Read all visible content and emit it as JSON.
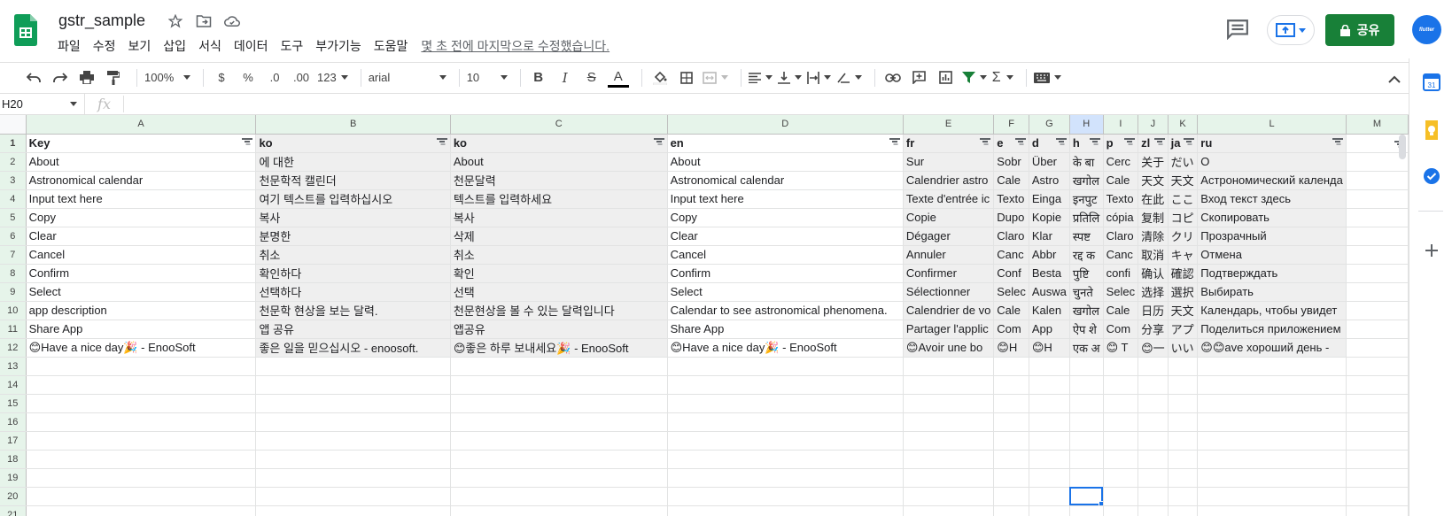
{
  "app": {
    "title": "gstr_sample",
    "last_edit": "몇 초 전에 마지막으로 수정했습니다.",
    "brand_color": "#0f9d58",
    "share_color": "#188038"
  },
  "menu": [
    "파일",
    "수정",
    "보기",
    "삽입",
    "서식",
    "데이터",
    "도구",
    "부가기능",
    "도움말"
  ],
  "header_actions": {
    "share_label": "공유",
    "avatar_text": "flutter"
  },
  "toolbar": {
    "zoom": "100%",
    "currency": "$",
    "percent": "%",
    "decrease_decimal": ".0",
    "increase_decimal": ".00",
    "more_formats": "123",
    "font": "arial",
    "font_size": "10",
    "bold": "B",
    "italic": "I",
    "strike": "S",
    "text_color": "A",
    "sum": "Σ"
  },
  "formula_bar": {
    "cell_ref": "H20",
    "fx": "fx",
    "value": ""
  },
  "sheet": {
    "columns": [
      "A",
      "B",
      "C",
      "D",
      "E",
      "F",
      "G",
      "H",
      "I",
      "J",
      "K",
      "L",
      "M"
    ],
    "row_numbers": [
      "1",
      "2",
      "3",
      "4",
      "5",
      "6",
      "7",
      "8",
      "9",
      "10",
      "11",
      "12",
      "13",
      "14",
      "15",
      "16",
      "17",
      "18",
      "19",
      "20",
      "21"
    ],
    "rows": [
      [
        "Key",
        "ko",
        "ko",
        "en",
        "fr",
        "e",
        "d",
        "h",
        "p",
        "zl",
        "ja",
        "ru",
        ""
      ],
      [
        "About",
        "에 대한",
        "About",
        "About",
        "Sur",
        "Sobr",
        "Über",
        "के बा",
        "Cerc",
        "关于",
        "だい",
        "О",
        ""
      ],
      [
        "Astronomical calendar",
        "천문학적 캘린더",
        "천문달력",
        "Astronomical calendar",
        "Calendrier astro",
        "Cale",
        "Astro",
        "खगोल",
        "Cale",
        "天文",
        "天文",
        "Астрономический календа",
        ""
      ],
      [
        "Input text here",
        "여기 텍스트를 입력하십시오",
        "텍스트를 입력하세요",
        "Input text here",
        "Texte d'entrée ic",
        "Texto",
        "Einga",
        "इनपुट",
        "Texto",
        "在此",
        "ここ",
        "Вход текст здесь",
        ""
      ],
      [
        "Copy",
        "복사",
        "복사",
        "Copy",
        "Copie",
        "Dupo",
        "Kopie",
        "प्रतिलि",
        "cópia",
        "复制",
        "コピ",
        "Скопировать",
        ""
      ],
      [
        "Clear",
        "분명한",
        "삭제",
        "Clear",
        "Dégager",
        "Claro",
        "Klar",
        "स्पष्ट",
        "Claro",
        "清除",
        "クリ",
        "Прозрачный",
        ""
      ],
      [
        "Cancel",
        "취소",
        "취소",
        "Cancel",
        "Annuler",
        "Canc",
        "Abbr",
        "रद्द क",
        "Canc",
        "取消",
        "キャ",
        "Отмена",
        ""
      ],
      [
        "Confirm",
        "확인하다",
        "확인",
        "Confirm",
        "Confirmer",
        "Conf",
        "Besta",
        "पुष्टि",
        "confi",
        "确认",
        "確認",
        "Подтверждать",
        ""
      ],
      [
        "Select",
        "선택하다",
        "선택",
        "Select",
        "Sélectionner",
        "Selec",
        "Auswa",
        "चुनते",
        "Selec",
        "选择",
        "選択",
        "Выбирать",
        ""
      ],
      [
        "app description",
        "천문학 현상을 보는 달력.",
        "천문현상을 볼 수 있는 달력입니다",
        "Calendar to see astronomical phenomena.",
        "Calendrier de vo",
        "Cale",
        "Kalen",
        "खगोल",
        "Cale",
        "日历",
        "天文",
        "Календарь, чтобы увидет",
        ""
      ],
      [
        "Share App",
        "앱 공유",
        "앱공유",
        "Share App",
        "Partager l'applic",
        "Com",
        "App",
        "ऐप शे",
        "Com",
        "分享",
        "アプ",
        "Поделиться приложением",
        ""
      ],
      [
        "😊Have a nice day🎉 - EnooSoft",
        "좋은 일을 믿으십시오 - enoosoft.",
        "😊좋은 하루 보내세요🎉 - EnooSoft",
        "😊Have a nice day🎉 - EnooSoft",
        "😊Avoir une bo",
        "😊H",
        "😊H",
        "एक अ",
        "😊 T",
        "😊一",
        "いい",
        "😊😊ave хороший день -",
        ""
      ],
      [
        "",
        "",
        "",
        "",
        "",
        "",
        "",
        "",
        "",
        "",
        "",
        "",
        ""
      ],
      [
        "",
        "",
        "",
        "",
        "",
        "",
        "",
        "",
        "",
        "",
        "",
        "",
        ""
      ],
      [
        "",
        "",
        "",
        "",
        "",
        "",
        "",
        "",
        "",
        "",
        "",
        "",
        ""
      ],
      [
        "",
        "",
        "",
        "",
        "",
        "",
        "",
        "",
        "",
        "",
        "",
        "",
        ""
      ],
      [
        "",
        "",
        "",
        "",
        "",
        "",
        "",
        "",
        "",
        "",
        "",
        "",
        ""
      ],
      [
        "",
        "",
        "",
        "",
        "",
        "",
        "",
        "",
        "",
        "",
        "",
        "",
        ""
      ],
      [
        "",
        "",
        "",
        "",
        "",
        "",
        "",
        "",
        "",
        "",
        "",
        "",
        ""
      ],
      [
        "",
        "",
        "",
        "",
        "",
        "",
        "",
        "",
        "",
        "",
        "",
        "",
        ""
      ],
      [
        "",
        "",
        "",
        "",
        "",
        "",
        "",
        "",
        "",
        "",
        "",
        "",
        ""
      ]
    ],
    "gray_columns": [
      "B",
      "C",
      "E",
      "F",
      "G",
      "H",
      "I",
      "J",
      "K",
      "L"
    ],
    "selected_cell": "H20"
  },
  "side_panel": {
    "calendar_label": "31"
  }
}
